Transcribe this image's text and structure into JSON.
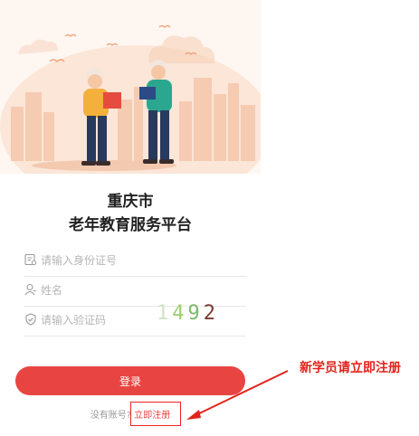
{
  "header": {
    "title_line1": "重庆市",
    "title_line2": "老年教育服务平台"
  },
  "form": {
    "id_placeholder": "请输入身份证号",
    "name_placeholder": "姓名",
    "code_placeholder": "请输入验证码",
    "captcha": [
      "1",
      "4",
      "9",
      "2"
    ],
    "captcha_colors": [
      "#cfe3c4",
      "#9ccf6a",
      "#7bb86b",
      "#7a3b32"
    ]
  },
  "login_button": "登录",
  "register": {
    "prompt": "没有账号?",
    "link": "立即注册"
  },
  "annotation": "新学员请立即注册",
  "icons": [
    "id-card-icon",
    "user-icon",
    "shield-check-icon"
  ],
  "colors": {
    "accent": "#e84542",
    "annotation": "#e2231a",
    "hero_bg": "#fdf0e6"
  }
}
